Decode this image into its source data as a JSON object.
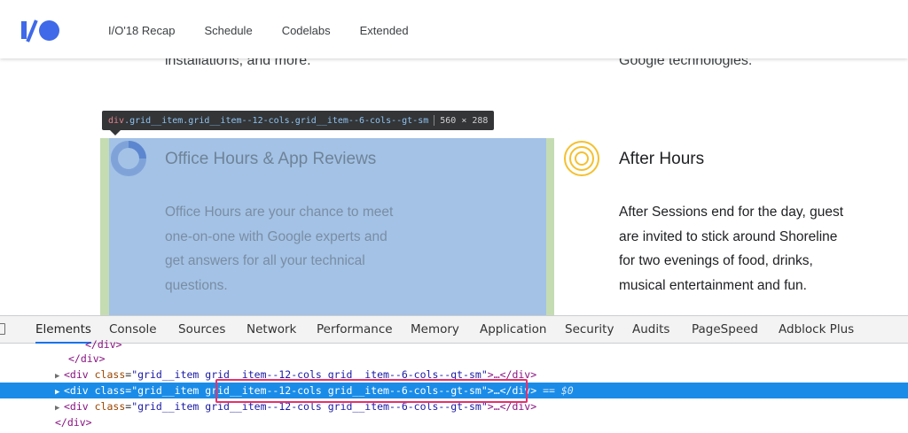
{
  "header": {
    "nav": [
      "I/O'18 Recap",
      "Schedule",
      "Codelabs",
      "Extended"
    ]
  },
  "content": {
    "cut_left": "installations, and more.",
    "cut_right": "Google technologies.",
    "tooltip": {
      "tag": "div",
      "classes": ".grid__item.grid__item--12-cols.grid__item--6-cols--gt-sm",
      "dims": "560 × 288"
    },
    "card_left": {
      "title": "Office Hours & App Reviews",
      "body": "Office Hours are your chance to meet one-on-one with Google experts and get answers for all your technical questions."
    },
    "card_right": {
      "title": "After Hours",
      "body": "After Sessions end for the day, guest are invited to stick around Shoreline for two evenings of food, drinks, musical entertainment and fun."
    }
  },
  "devtools": {
    "tabs": [
      "Elements",
      "Console",
      "Sources",
      "Network",
      "Performance",
      "Memory",
      "Application",
      "Security",
      "Audits",
      "PageSpeed",
      "Adblock Plus"
    ],
    "active_tab": "Elements",
    "lines": [
      {
        "text": "</div>"
      },
      {
        "text": "</div>"
      },
      {
        "open": "<div ",
        "attr": "class",
        "val": "\"grid__item grid__item--12-cols grid__item--6-cols--gt-sm\"",
        "close": ">…</div>"
      },
      {
        "open": "<div ",
        "attr": "class",
        "val": "\"grid__item grid__item--12-cols grid__item--6-cols--gt-sm\"",
        "close": ">…</div>",
        "suffix": "== $0"
      },
      {
        "open": "<div ",
        "attr": "class",
        "val": "\"grid__item grid__item--12-cols grid__item--6-cols--gt-sm\"",
        "close": ">…</div>"
      },
      {
        "text": "</div>"
      }
    ]
  },
  "colors": {
    "brand_blue": "#3f69e8",
    "highlight_content": "#a3c2e6",
    "highlight_margin": "#c5dcb3",
    "selection": "#1a8ce8",
    "annotation_red": "#e8306c"
  }
}
